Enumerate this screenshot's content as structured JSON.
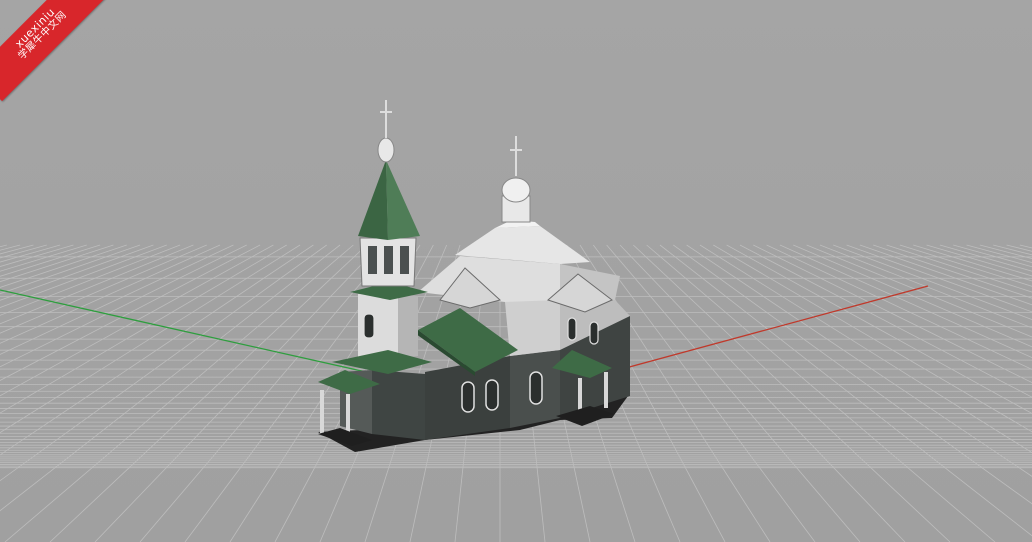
{
  "viewport": {
    "label": "perspective-viewport",
    "colors": {
      "background": "#a3a3a3",
      "grid_line": "#bdbdbd",
      "grid_major": "#c8c8c8",
      "x_axis": "#c0392b",
      "y_axis": "#2e9e3e",
      "roof_green": "#3e6b46",
      "wall_white": "#d9d9d9",
      "wall_dark": "#3a3f3d"
    }
  },
  "watermark": {
    "line1": "xuexiniu",
    "line2": "学犀牛中文网",
    "color": "#d8262b"
  },
  "model": {
    "name": "church"
  }
}
